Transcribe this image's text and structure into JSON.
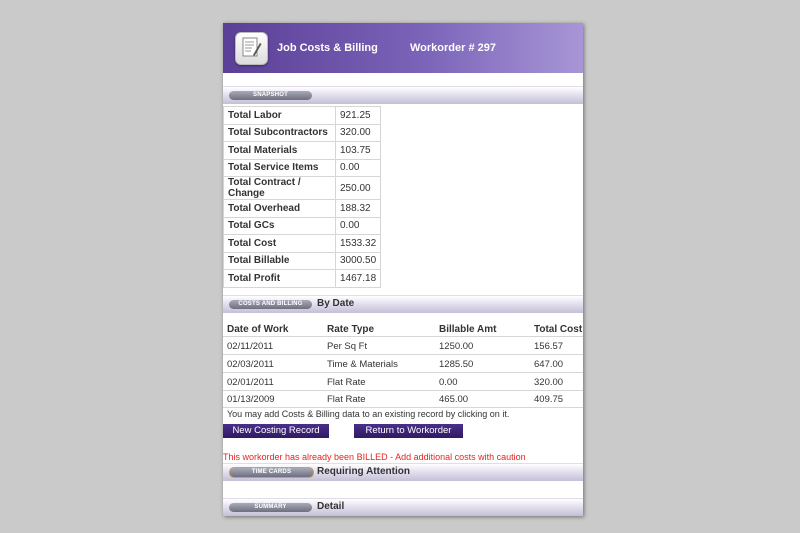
{
  "header": {
    "title": "Job Costs & Billing",
    "workorder": "Workorder # 297"
  },
  "snapshot": {
    "pill": "SNAPSHOT",
    "rows": [
      {
        "label": "Total Labor",
        "value": "921.25"
      },
      {
        "label": "Total Subcontractors",
        "value": "320.00"
      },
      {
        "label": "Total Materials",
        "value": "103.75"
      },
      {
        "label": "Total Service Items",
        "value": "0.00"
      },
      {
        "label": "Total Contract / Change",
        "value": "250.00"
      },
      {
        "label": "Total Overhead",
        "value": "188.32"
      },
      {
        "label": "Total GCs",
        "value": "0.00"
      },
      {
        "label": "Total Cost",
        "value": "1533.32"
      },
      {
        "label": "Total Billable",
        "value": "3000.50"
      },
      {
        "label": "Total Profit",
        "value": "1467.18"
      }
    ]
  },
  "costs": {
    "pill": "COSTS AND BILLING",
    "label": "By Date",
    "columns": [
      "Date of Work",
      "Rate Type",
      "Billable Amt",
      "Total Cost"
    ],
    "rows": [
      [
        "02/11/2011",
        "Per Sq Ft",
        "1250.00",
        "156.57"
      ],
      [
        "02/03/2011",
        "Time & Materials",
        "1285.50",
        "647.00"
      ],
      [
        "02/01/2011",
        "Flat Rate",
        "0.00",
        "320.00"
      ],
      [
        "01/13/2009",
        "Flat Rate",
        "465.00",
        "409.75"
      ]
    ],
    "info": "You may add Costs & Billing data to an existing record by clicking on it.",
    "new_button": "New Costing Record",
    "return_button": "Return to Workorder"
  },
  "warning": "This workorder has already been BILLED - Add additional costs with caution",
  "timecards": {
    "pill": "TIME CARDS",
    "label": "Requiring Attention"
  },
  "summary": {
    "pill": "SUMMARY",
    "label": "Detail"
  },
  "colors": {
    "header": "#5b3f96",
    "button": "#3a2275",
    "warning": "#e8231e"
  },
  "icons": {
    "app": "document-icon"
  }
}
